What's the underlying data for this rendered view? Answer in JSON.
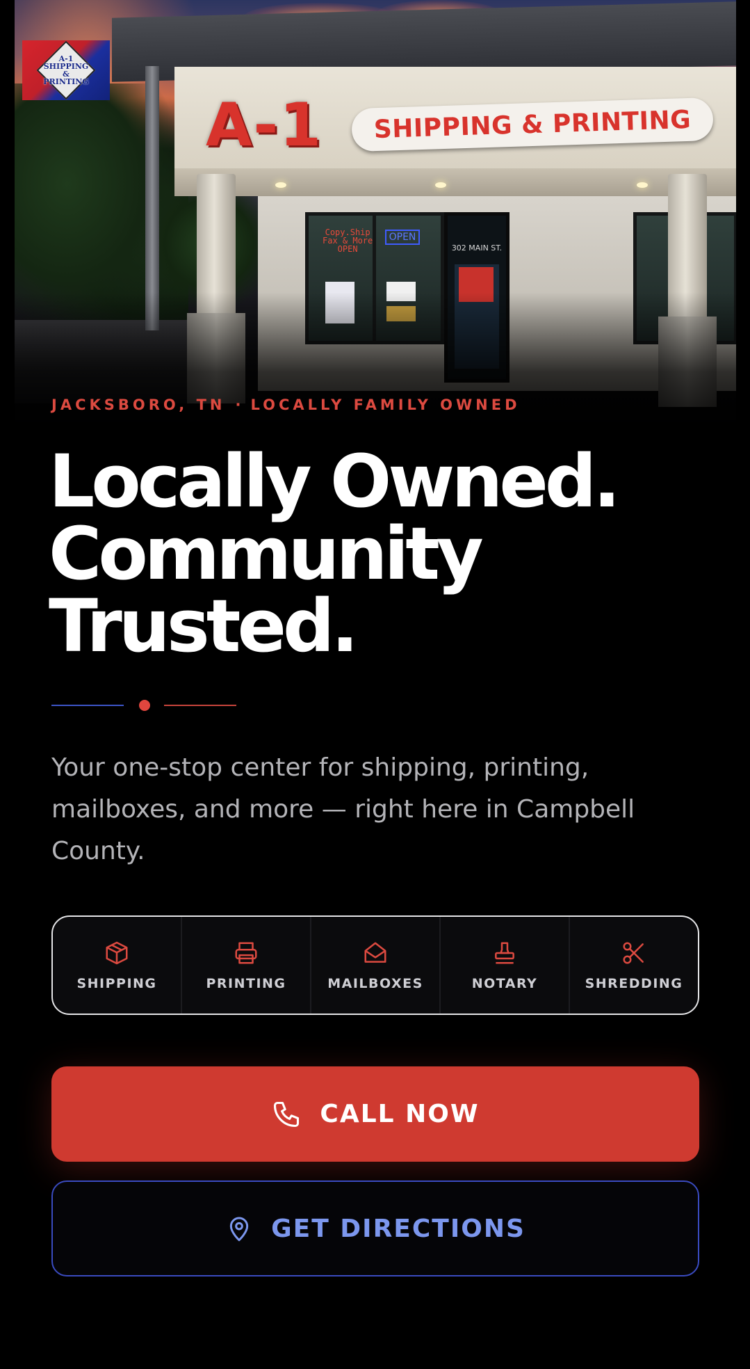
{
  "hero": {
    "sign_main": "A-1",
    "sign_banner": "SHIPPING & PRINTING",
    "address_window": "302 MAIN ST.",
    "neon_left": "Copy.Ship\nFax & More\nOPEN",
    "neon_right": "OPEN"
  },
  "logo": {
    "lines": [
      "A-1",
      "SHIPPING",
      "&",
      "PRINTING"
    ]
  },
  "eyebrow": {
    "location": "JACKSBORO, TN",
    "separator": "·",
    "tagline": "LOCALLY FAMILY OWNED"
  },
  "headline": {
    "line1": "Locally Owned.",
    "line2": "Community",
    "line3": "Trusted."
  },
  "lead": "Your one-stop center for shipping, printing, mailboxes, and more — right here in Campbell County.",
  "services": [
    {
      "label": "SHIPPING",
      "icon": "box-icon"
    },
    {
      "label": "PRINTING",
      "icon": "printer-icon"
    },
    {
      "label": "MAILBOXES",
      "icon": "envelope-open-icon"
    },
    {
      "label": "NOTARY",
      "icon": "stamp-icon"
    },
    {
      "label": "SHREDDING",
      "icon": "scissors-icon"
    }
  ],
  "cta": {
    "call_label": "CALL NOW",
    "call_icon": "phone-icon",
    "directions_label": "GET DIRECTIONS",
    "directions_icon": "map-pin-icon"
  },
  "colors": {
    "accent_red": "#cf3a30",
    "eyebrow_red": "#dc4a40",
    "accent_blue": "#7c97ee",
    "border_blue": "#3a4bc0",
    "background": "#000000"
  }
}
